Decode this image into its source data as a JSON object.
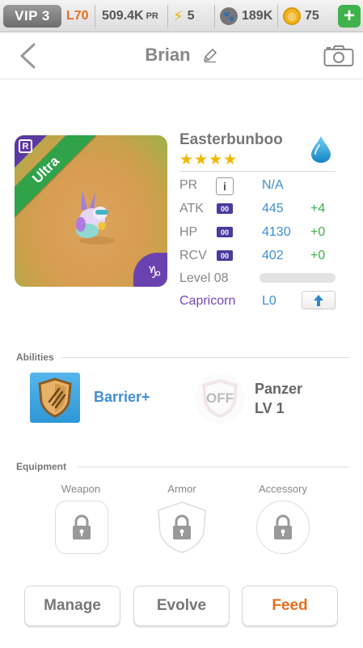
{
  "status": {
    "vip": "VIP 3",
    "level": "L70",
    "pr_value": "509.4K",
    "pr_unit": "PR",
    "energy": "5",
    "paws": "189K",
    "coins": "75",
    "plus": "+"
  },
  "header": {
    "title": "Brian"
  },
  "pet": {
    "name": "Easterbunboo",
    "stars": "★★★★",
    "star_count": 4,
    "rarity_letter": "R",
    "rarity_tier": "Ultra",
    "zodiac_symbol": "♑",
    "element": "water",
    "stats": {
      "pr_label": "PR",
      "pr_value": "N/A",
      "info": "i",
      "atk_label": "ATK",
      "atk_value": "445",
      "atk_bonus": "+4",
      "hp_label": "HP",
      "hp_value": "4130",
      "hp_bonus": "+0",
      "rcv_label": "RCV",
      "rcv_value": "402",
      "rcv_bonus": "+0",
      "gem": "00",
      "level": "Level 08",
      "level_progress": 0.0
    },
    "zodiac": {
      "name": "Capricorn",
      "level": "L0"
    }
  },
  "abilities": {
    "header": "Abilities",
    "items": [
      {
        "name": "Barrier+",
        "icon": "shield-claw-icon"
      },
      {
        "name": "Panzer",
        "level": "LV 1",
        "state": "OFF"
      }
    ]
  },
  "equipment": {
    "header": "Equipment",
    "slots": [
      {
        "label": "Weapon"
      },
      {
        "label": "Armor"
      },
      {
        "label": "Accessory"
      }
    ]
  },
  "actions": {
    "manage": "Manage",
    "evolve": "Evolve",
    "feed": "Feed"
  },
  "colors": {
    "accent_blue": "#3f8fd4",
    "bonus_green": "#3fb24b",
    "zodiac_purple": "#7a47b6",
    "feed_orange": "#e5701f",
    "ultra_ribbon": "#2fa24a"
  }
}
